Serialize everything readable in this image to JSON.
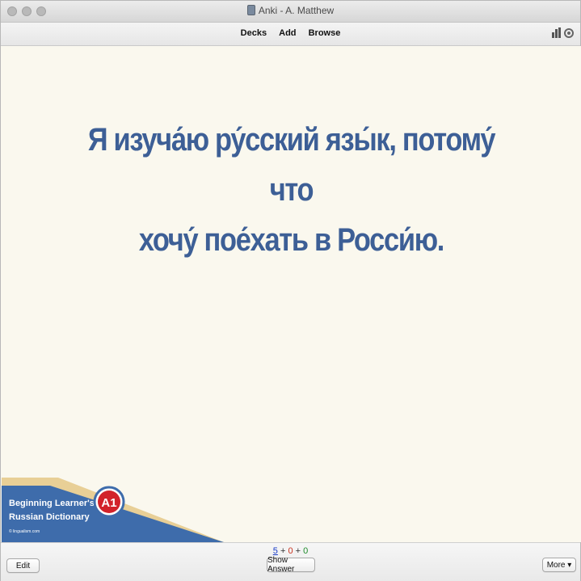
{
  "window": {
    "title": "Anki - A. Matthew"
  },
  "toolbar": {
    "decks": "Decks",
    "add": "Add",
    "browse": "Browse"
  },
  "card": {
    "line1": "Я изуча́ю ру́сский язы́к, потому́ что",
    "line2": "хочу́ пое́хать в Росси́ю."
  },
  "banner": {
    "title_line1": "Beginning Learner's",
    "title_line2": "Russian Dictionary",
    "website": "© lingualism.com",
    "level": "A1",
    "colors": {
      "blue": "#3e6cab",
      "gold": "#e8cf96",
      "red": "#d2222a"
    }
  },
  "footer": {
    "counts": {
      "new": "5",
      "learning": "0",
      "review": "0",
      "sep": "+"
    },
    "edit": "Edit",
    "show_answer": "Show Answer",
    "more": "More ▾"
  }
}
